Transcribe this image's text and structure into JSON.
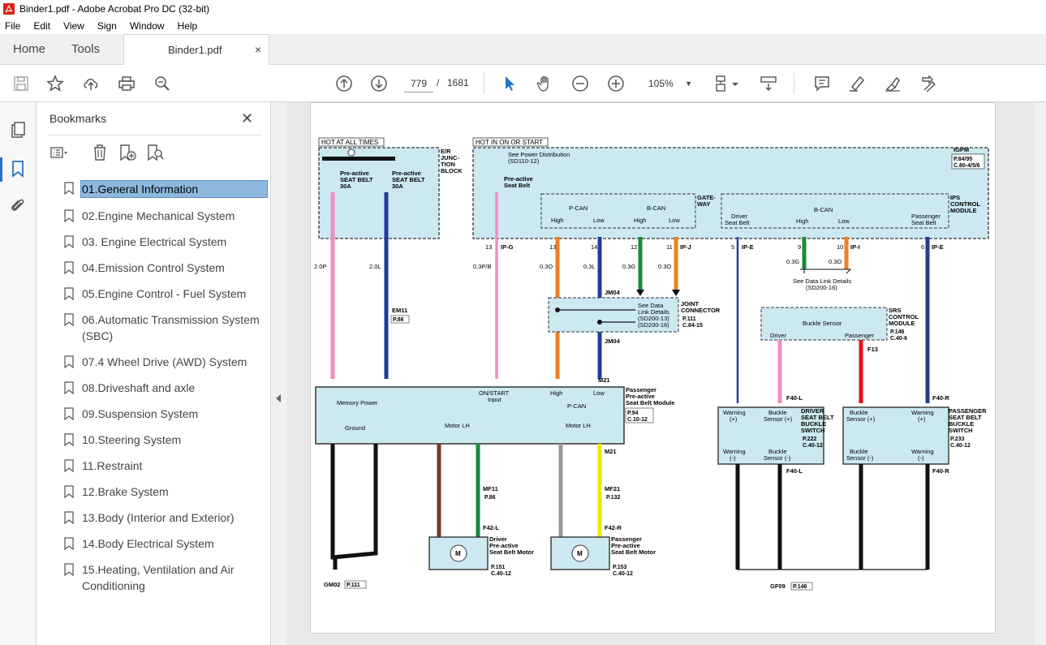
{
  "window": {
    "title": "Binder1.pdf - Adobe Acrobat Pro DC (32-bit)"
  },
  "menu": [
    "File",
    "Edit",
    "View",
    "Sign",
    "Window",
    "Help"
  ],
  "tabs": {
    "home": "Home",
    "tools": "Tools",
    "document": "Binder1.pdf",
    "close": "×"
  },
  "toolbar": {
    "page_current": "779",
    "page_sep": "/",
    "page_total": "1681",
    "zoom": "105%"
  },
  "bookmarks": {
    "header": "Bookmarks",
    "close": "✕",
    "items": [
      {
        "label": "01.General Information",
        "selected": true
      },
      {
        "label": "02.Engine Mechanical System"
      },
      {
        "label": "03. Engine Electrical System"
      },
      {
        "label": "04.Emission Control System"
      },
      {
        "label": "05.Engine Control - Fuel System"
      },
      {
        "label": "06.Automatic Transmission System (SBC)"
      },
      {
        "label": "07.4 Wheel Drive (AWD) System"
      },
      {
        "label": "08.Driveshaft and axle"
      },
      {
        "label": "09.Suspension System"
      },
      {
        "label": "10.Steering System"
      },
      {
        "label": "11.Restraint"
      },
      {
        "label": "12.Brake System"
      },
      {
        "label": "13.Body (Interior and Exterior)"
      },
      {
        "label": "14.Body Electrical System"
      },
      {
        "label": "15.Heating, Ventilation and Air Conditioning"
      }
    ]
  },
  "diagram": {
    "hot_at_all_times": "HOT AT ALL TIMES",
    "hot_in_on": "HOT IN ON OR START",
    "er_block": [
      "E/R",
      "JUNC-",
      "TION",
      "BLOCK"
    ],
    "fuse1": [
      "Pre-active",
      "SEAT BELT",
      "30A"
    ],
    "fuse2": [
      "Pre-active",
      "SEAT BELT",
      "30A"
    ],
    "see_power": [
      "See Power Distribution",
      "(SD110-12)"
    ],
    "preactive_seatbelt": [
      "Pre-active",
      "Seat Belt"
    ],
    "igpm": [
      "IGPM",
      "P.84/95",
      "C.80-4/5/6"
    ],
    "gateway": [
      "GATE-",
      "WAY"
    ],
    "pcan": "P-CAN",
    "bcan": "B-CAN",
    "high": "High",
    "low": "Low",
    "driver_seatbelt": [
      "Driver",
      "Seat Belt"
    ],
    "passenger_seatbelt": [
      "Passenger",
      "Seat Belt"
    ],
    "ips": [
      "IPS",
      "CONTROL",
      "MODULE"
    ],
    "wire_labels_top": [
      "13",
      "IP-G",
      "13",
      "14",
      "12",
      "11",
      "IP-J",
      "5",
      "IP-E",
      "9",
      "10",
      "IP-I",
      "6",
      "IP-E"
    ],
    "gauge_labels": [
      "2.0P",
      "2.0L",
      "0.3P/B",
      "0.3O",
      "0.3L",
      "0.3G",
      "0.3O",
      "0.3G",
      "0.3O"
    ],
    "see_data_link": [
      "See Data Link Details",
      "(SD200-16)"
    ],
    "joint_connector": [
      "JOINT",
      "CONNECTOR",
      "P.111",
      "C.84-15"
    ],
    "see_data_link2": [
      "See Data",
      "Link Details",
      "(SD200-13)",
      "(SD200-16)"
    ],
    "jm04": "JM04",
    "em11": [
      "EM11",
      "P.86"
    ],
    "m21": "M21",
    "module_label": [
      "Passenger",
      "Pre-active",
      "Seat Belt Module",
      "P.94",
      "C.10-12"
    ],
    "memory_power": "Memory Power",
    "on_start": [
      "ON/START",
      "Input"
    ],
    "ground": "Ground",
    "motor_lh": "Motor LH",
    "srs": [
      "SRS",
      "CONTROL",
      "MODULE",
      "P.146",
      "C.40-6"
    ],
    "buckle_sensor": "Buckle Sensor",
    "driver": "Driver",
    "passenger": "Passenger",
    "f13": "F13",
    "f40l": "F40-L",
    "f40r": "F40-R",
    "driver_buckle": [
      "DRIVER",
      "SEAT BELT",
      "BUCKLE",
      "SWITCH",
      "P.222",
      "C.40-12"
    ],
    "pass_buckle": [
      "PASSENGER",
      "SEAT BELT",
      "BUCKLE",
      "SWITCH",
      "P.233",
      "C.40-12"
    ],
    "warning_plus": [
      "Warning",
      "(+)"
    ],
    "warning_minus": [
      "Warning",
      "(-)"
    ],
    "buckle_plus": [
      "Buckle",
      "Sensor (+)"
    ],
    "buckle_minus": [
      "Buckle",
      "Sensor (-)"
    ],
    "mf11": [
      "MF11",
      "P.86"
    ],
    "mf21": [
      "MF21",
      "P.132"
    ],
    "f42l": "F42-L",
    "f42r": "F42-R",
    "driver_motor": [
      "Driver",
      "Pre-active",
      "Seat Belt Motor",
      "P.151",
      "C.40-12"
    ],
    "pass_motor": [
      "Passenger",
      "Pre-active",
      "Seat Belt Motor",
      "P.153",
      "C.40-12"
    ],
    "gm02": [
      "GM02",
      "P.111"
    ],
    "gf09": [
      "GF09",
      "P.146"
    ],
    "m": "M"
  }
}
